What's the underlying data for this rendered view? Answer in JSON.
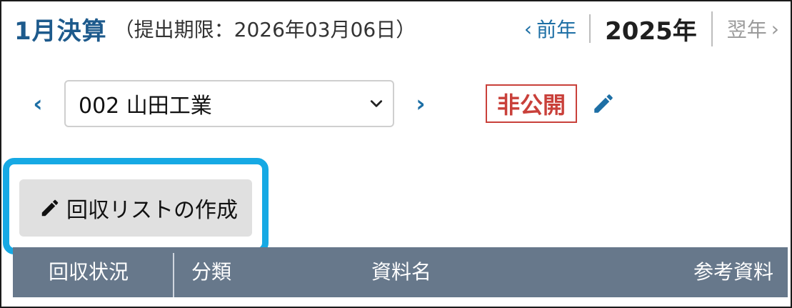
{
  "header": {
    "month_title": "1月決算",
    "deadline": "（提出期限：2026年03月06日）"
  },
  "year_nav": {
    "prev_label": "前年",
    "current_year": "2025年",
    "next_label": "翌年"
  },
  "company_select": {
    "selected": "002 山田工業"
  },
  "visibility_badge": "非公開",
  "create_button": {
    "label": "回収リストの作成"
  },
  "table": {
    "columns": [
      "回収状況",
      "分類",
      "資料名",
      "参考資料"
    ]
  },
  "colors": {
    "title": "#1d5a8c",
    "link": "#1d6fa5",
    "badge_red": "#c9403a",
    "highlight": "#16a9e4",
    "table_header_bg": "#67788b"
  },
  "icons": [
    "chevron-left-icon",
    "chevron-right-icon",
    "chevron-down-icon",
    "pencil-icon"
  ]
}
